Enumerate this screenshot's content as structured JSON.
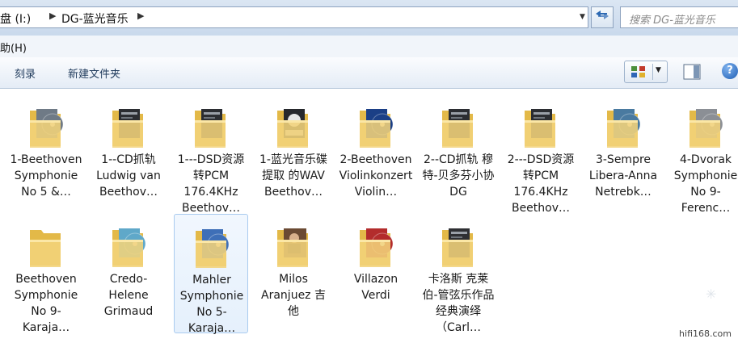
{
  "address": {
    "drive": "盘 (I:)",
    "folder": "DG-蓝光音乐",
    "sep": "▶"
  },
  "search": {
    "placeholder": "搜索 DG-蓝光音乐"
  },
  "menu": {
    "help": "助(H)"
  },
  "toolbar": {
    "burn": "刻录",
    "new_folder": "新建文件夹"
  },
  "items": [
    {
      "label": "1-Beethoven Symphonie No 5 &…",
      "thumb": "disc-gray",
      "color": "#6f7a86"
    },
    {
      "label": "1--CD抓轨 Ludwig van Beethov…",
      "thumb": "dark",
      "color": "#2b2d32"
    },
    {
      "label": "1---DSD资源转PCM 176.4KHz Beethov…",
      "thumb": "dark",
      "color": "#2b2d32"
    },
    {
      "label": "1-蓝光音乐碟提取 的WAV Beethov…",
      "thumb": "wav",
      "color": "#26282c"
    },
    {
      "label": "2-Beethoven Violinkonzert Violin…",
      "thumb": "disc-blue",
      "color": "#1b3f86"
    },
    {
      "label": "2--CD抓轨 穆特-贝多芬小协 DG",
      "thumb": "dark",
      "color": "#2b2d32"
    },
    {
      "label": "2---DSD资源转PCM 176.4KHz Beethov…",
      "thumb": "dark",
      "color": "#2b2d32"
    },
    {
      "label": "3-Sempre Libera-Anna Netrebk…",
      "thumb": "disc-teal",
      "color": "#4a7aa0"
    },
    {
      "label": "4-Dvorak Symphonie No 9-Ferenc…",
      "thumb": "disc-gray",
      "color": "#8b8f95"
    },
    {
      "label": "Beethoven Symphonie No 9-Karaja…",
      "thumb": "plain",
      "color": "#e8c45c"
    },
    {
      "label": "Credo-Helene Grimaud",
      "thumb": "disc-cyan",
      "color": "#5fa8c9"
    },
    {
      "label": "Mahler Symphonie No 5-Karaja…",
      "thumb": "disc-blue",
      "color": "#3e6fb7"
    },
    {
      "label": "Milos Aranjuez 吉他",
      "thumb": "photo",
      "color": "#6b4a33"
    },
    {
      "label": "Villazon Verdi",
      "thumb": "disc-red",
      "color": "#b32c2c"
    },
    {
      "label": "卡洛斯 克莱伯-管弦乐作品经典演绎（Carl…",
      "thumb": "dark",
      "color": "#2e2f33"
    }
  ],
  "watermark": "hifi168.com",
  "sparkle": "✳"
}
